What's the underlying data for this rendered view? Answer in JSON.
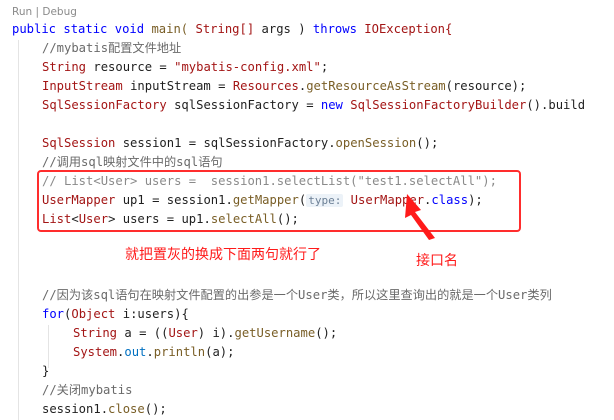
{
  "codelens": {
    "run": "Run",
    "separator": "|",
    "debug": "Debug"
  },
  "code": {
    "l1": [
      "public",
      "static",
      "void",
      "main(",
      "String[]",
      "args",
      ")",
      "throws",
      "IOException{"
    ],
    "l2_comment": "//mybatis配置文件地址",
    "l3": {
      "type": "String",
      "name": "resource",
      "eq": "=",
      "str": "\"mybatis-config.xml\"",
      "end": ";"
    },
    "l4": {
      "type": "InputStream",
      "name": "inputStream",
      "eq": "=",
      "cls": "Resources",
      "dot": ".",
      "fn": "getResourceAsStream",
      "args": "(resource);"
    },
    "l5": {
      "type": "SqlSessionFactory",
      "name": "sqlSessionFactory",
      "eq": "=",
      "new": "new",
      "cls": "SqlSessionFactoryBuilder",
      "tail": "().build"
    },
    "l7": {
      "type": "SqlSession",
      "name": "session1",
      "eq": "=",
      "obj": "sqlSessionFactory",
      "dot": ".",
      "fn": "openSession",
      "end": "();"
    },
    "l8_comment": "//调用sql映射文件中的sql语句",
    "l9_comment": "// List<User> users =  session1.selectList(\"test1.selectAll\");",
    "l10": {
      "type": "UserMapper",
      "name": "up1",
      "eq": "=",
      "obj": "session1",
      "dot": ".",
      "fn": "getMapper",
      "open": "(",
      "hint": "type:",
      "cls": "UserMapper",
      "dot2": ".",
      "fld": "class",
      "end": ");"
    },
    "l11": {
      "type1": "List",
      "lt": "<",
      "type2": "User",
      "gt": ">",
      "name": "users",
      "eq": "=",
      "obj": "up1",
      "dot": ".",
      "fn": "selectAll",
      "end": "();"
    },
    "l13_comment": "//因为该sql语句在映射文件配置的出参是一个User类，所以这里查询出的就是一个User类列",
    "l14": {
      "kw": "for",
      "open": "(",
      "type": "Object",
      "name": "i",
      "colon": ":",
      "coll": "users",
      "end": "){"
    },
    "l15": {
      "type": "String",
      "name": "a",
      "eq": "=",
      "pre": "((",
      "cast": "User",
      "mid": ") i).",
      "fn": "getUsername",
      "end": "();"
    },
    "l16": {
      "cls": "System",
      "dot": ".",
      "fld": "out",
      "dot2": ".",
      "fn": "println",
      "end": "(a);"
    },
    "l17": "}",
    "l18_comment": "//关闭mybatis",
    "l19": {
      "obj": "session1",
      "dot": ".",
      "fn": "close",
      "end": "();"
    }
  },
  "annotations": {
    "replace_note": "就把置灰的换成下面两句就行了",
    "interface_note": "接口名",
    "color": "#ff1a1a"
  }
}
